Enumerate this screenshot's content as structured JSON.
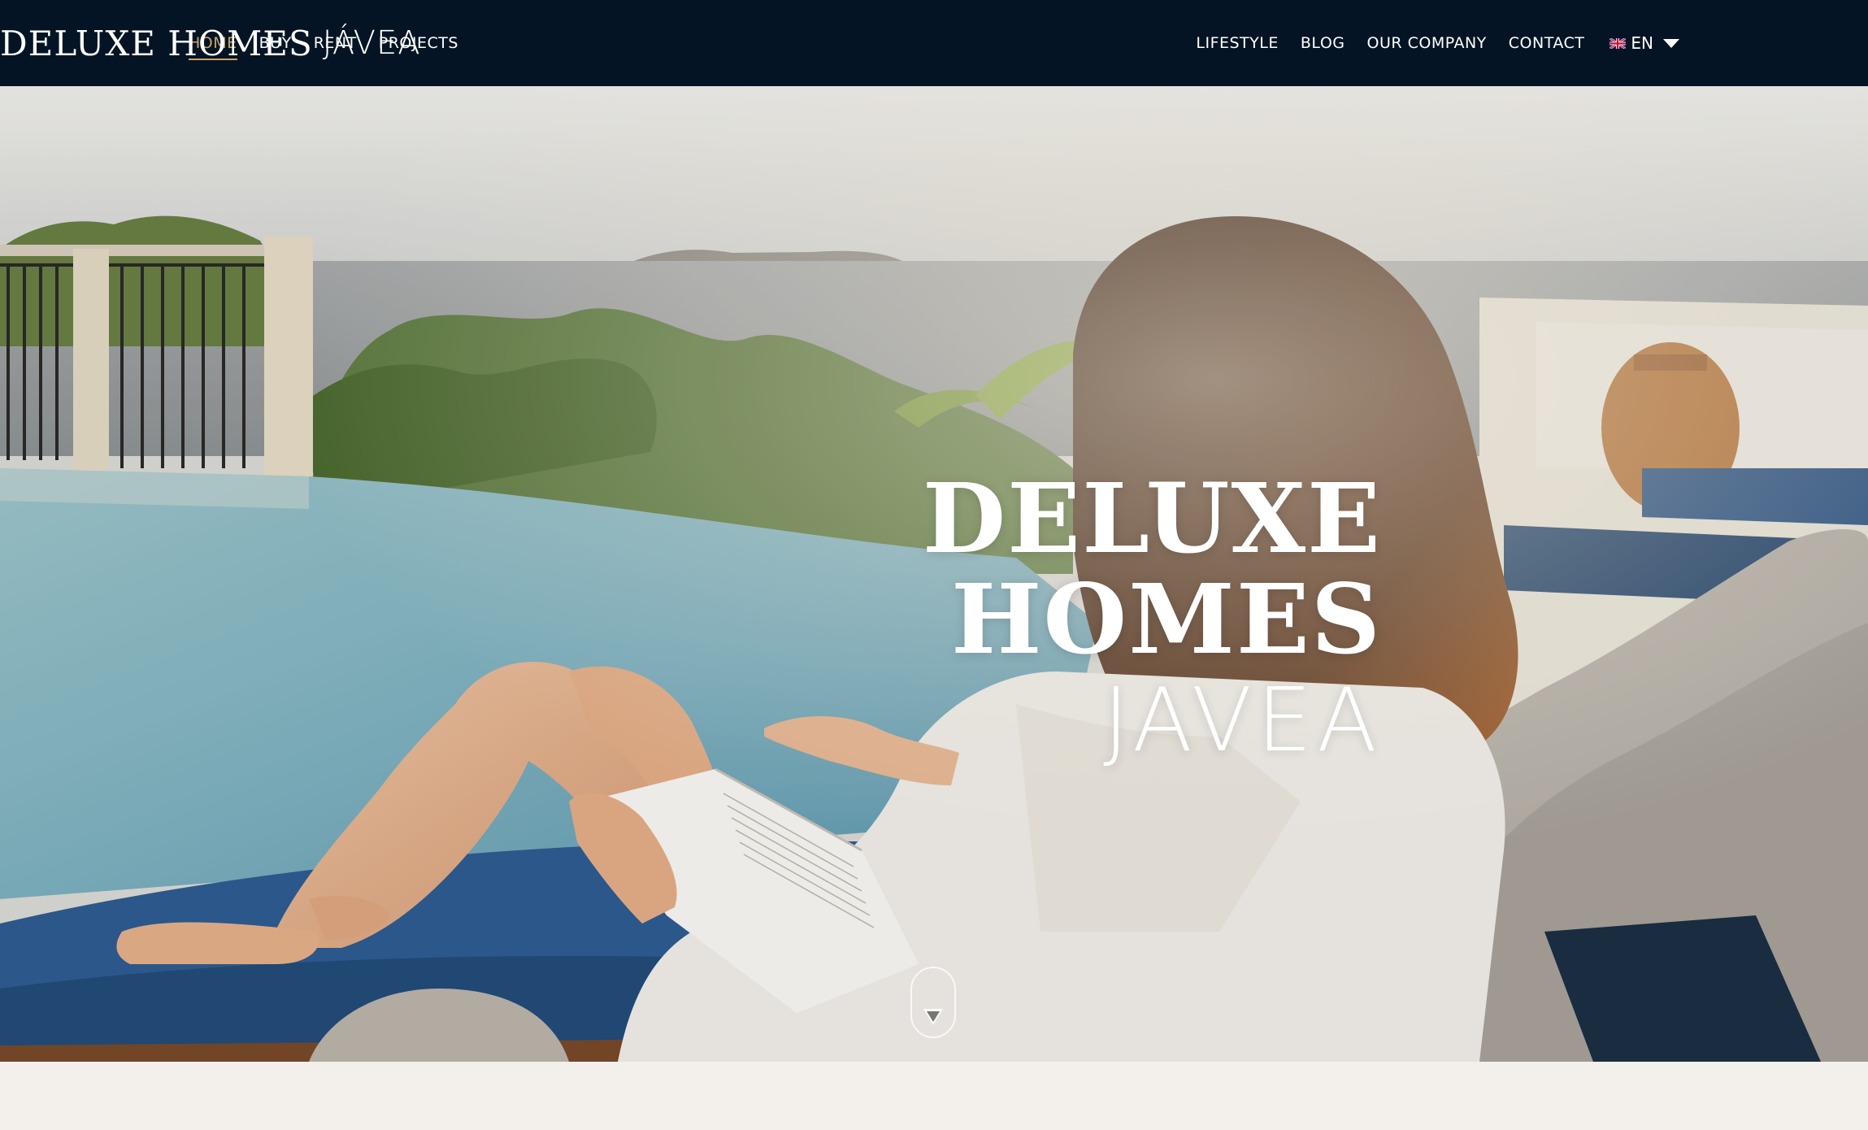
{
  "nav": {
    "left_items": [
      {
        "label": "HOME",
        "active": true
      },
      {
        "label": "BUY",
        "active": false
      },
      {
        "label": "RENT",
        "active": false
      },
      {
        "label": "PROJECTS",
        "active": false
      }
    ],
    "brand": {
      "primary": "DELUXE HOMES",
      "secondary": "JÁVEA"
    },
    "right_items": [
      {
        "label": "LIFESTYLE"
      },
      {
        "label": "BLOG"
      },
      {
        "label": "OUR COMPANY"
      },
      {
        "label": "CONTACT"
      }
    ],
    "language": {
      "label": "EN",
      "flag_icon": "uk-flag-icon"
    }
  },
  "hero": {
    "title_line1": "DELUXE HOMES",
    "title_line2": "JAVEA",
    "scroll_icon": "chevron-down-icon"
  },
  "colors": {
    "nav_background": "#051424",
    "accent": "#c9a46a",
    "page_background": "#f3efeb"
  }
}
